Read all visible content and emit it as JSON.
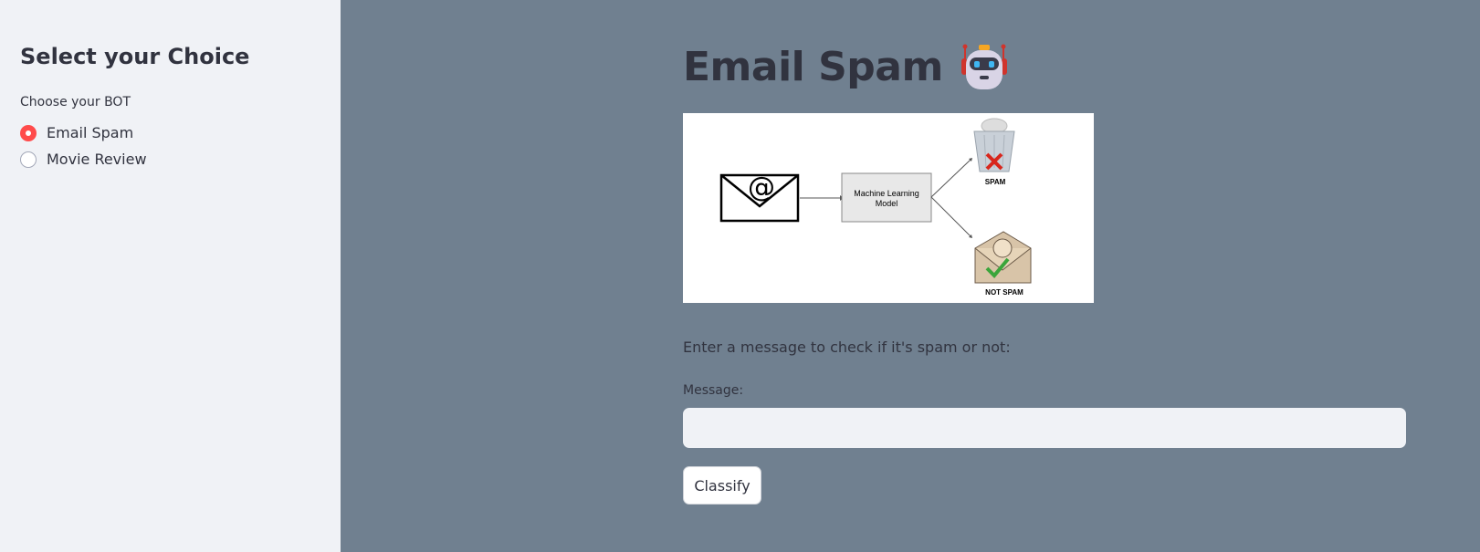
{
  "sidebar": {
    "title": "Select your Choice",
    "radio_label": "Choose your BOT",
    "options": [
      {
        "label": "Email Spam",
        "selected": true
      },
      {
        "label": "Movie Review",
        "selected": false
      }
    ]
  },
  "main": {
    "title": "Email Spam",
    "title_icon": "robot-icon",
    "diagram": {
      "box_label_line1": "Machine Learning",
      "box_label_line2": "Model",
      "spam_label": "SPAM",
      "not_spam_label": "NOT SPAM"
    },
    "prompt": "Enter a message to check if it's spam or not:",
    "message_label": "Message:",
    "message_value": "",
    "button_label": "Classify"
  },
  "colors": {
    "main_bg": "#708090",
    "sidebar_bg": "#f0f2f6",
    "accent": "#ff4b4b",
    "text": "#31333f"
  }
}
